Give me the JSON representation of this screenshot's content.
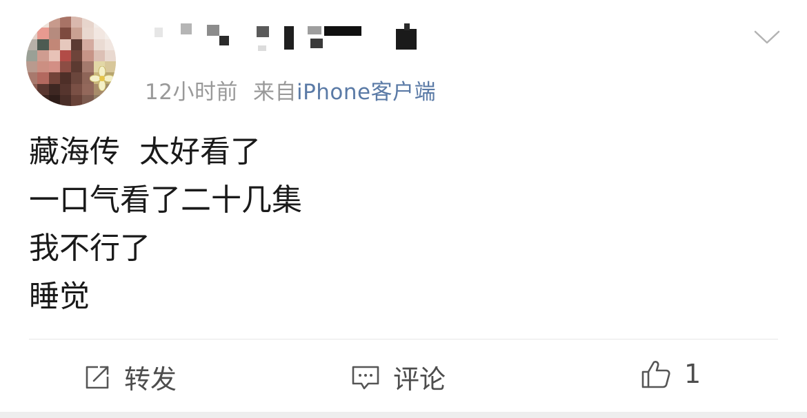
{
  "post": {
    "time": "12小时前",
    "source_prefix": "来自",
    "source": "iPhone客户端",
    "content_lines": [
      "藏海传  太好看了",
      "一口气看了二十几集",
      "我不行了",
      "睡觉"
    ]
  },
  "actions": {
    "repost_label": "转发",
    "comment_label": "评论",
    "like_count": "1"
  },
  "colors": {
    "source_link": "#5a7aa6",
    "meta_text": "#999999",
    "body_text": "#1a1a1a",
    "action_text": "#4d4d4d"
  },
  "icons": [
    "avatar",
    "expand-chevron-icon",
    "repost-icon",
    "comment-icon",
    "like-thumb-icon"
  ]
}
